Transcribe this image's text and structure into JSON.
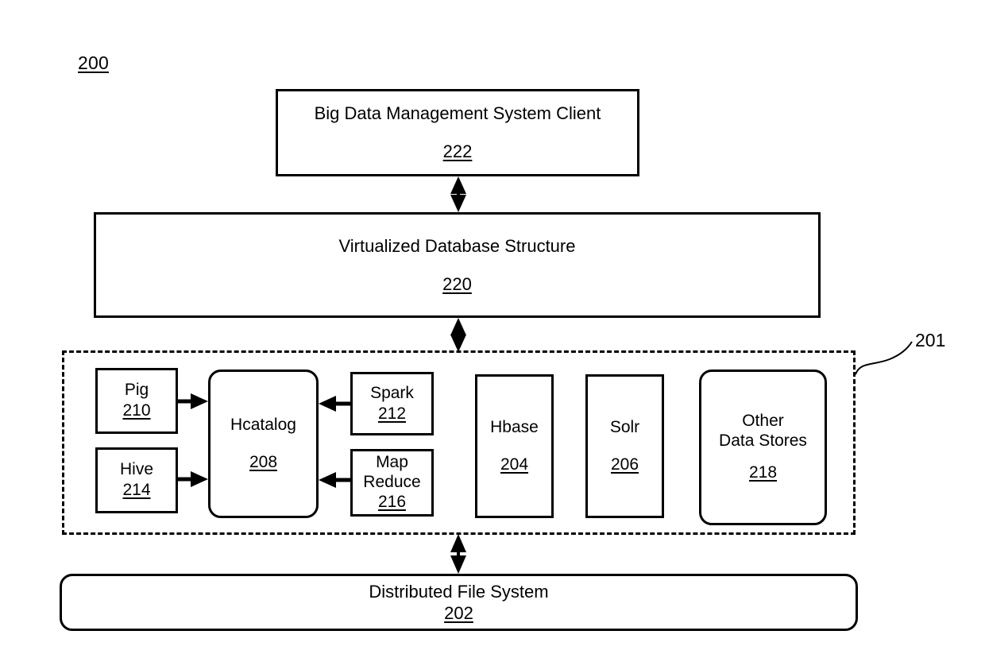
{
  "figure": {
    "number": "200",
    "region_ref": "201"
  },
  "nodes": {
    "client": {
      "title": "Big Data Management System Client",
      "ref": "222"
    },
    "virtualized_db": {
      "title": "Virtualized Database Structure",
      "ref": "220"
    },
    "pig": {
      "title": "Pig",
      "ref": "210"
    },
    "hive": {
      "title": "Hive",
      "ref": "214"
    },
    "hcatalog": {
      "title": "Hcatalog",
      "ref": "208"
    },
    "spark": {
      "title": "Spark",
      "ref": "212"
    },
    "mapreduce": {
      "title": "Map\nReduce",
      "ref": "216"
    },
    "hbase": {
      "title": "Hbase",
      "ref": "204"
    },
    "solr": {
      "title": "Solr",
      "ref": "206"
    },
    "other_data_stores": {
      "title": "Other\nData Stores",
      "ref": "218"
    },
    "dfs": {
      "title": "Distributed File System",
      "ref": "202"
    }
  },
  "connectors": [
    {
      "name": "client-to-virtualized-db",
      "kind": "bidirectional-vertical"
    },
    {
      "name": "virtualized-db-to-region",
      "kind": "bidirectional-vertical"
    },
    {
      "name": "region-to-dfs",
      "kind": "bidirectional-vertical"
    },
    {
      "name": "pig-to-hcatalog",
      "kind": "arrow-right"
    },
    {
      "name": "hive-to-hcatalog",
      "kind": "arrow-right"
    },
    {
      "name": "spark-to-hcatalog",
      "kind": "arrow-left"
    },
    {
      "name": "mapreduce-to-hcatalog",
      "kind": "arrow-left"
    }
  ],
  "colors": {
    "stroke": "#000000",
    "background": "#ffffff"
  }
}
